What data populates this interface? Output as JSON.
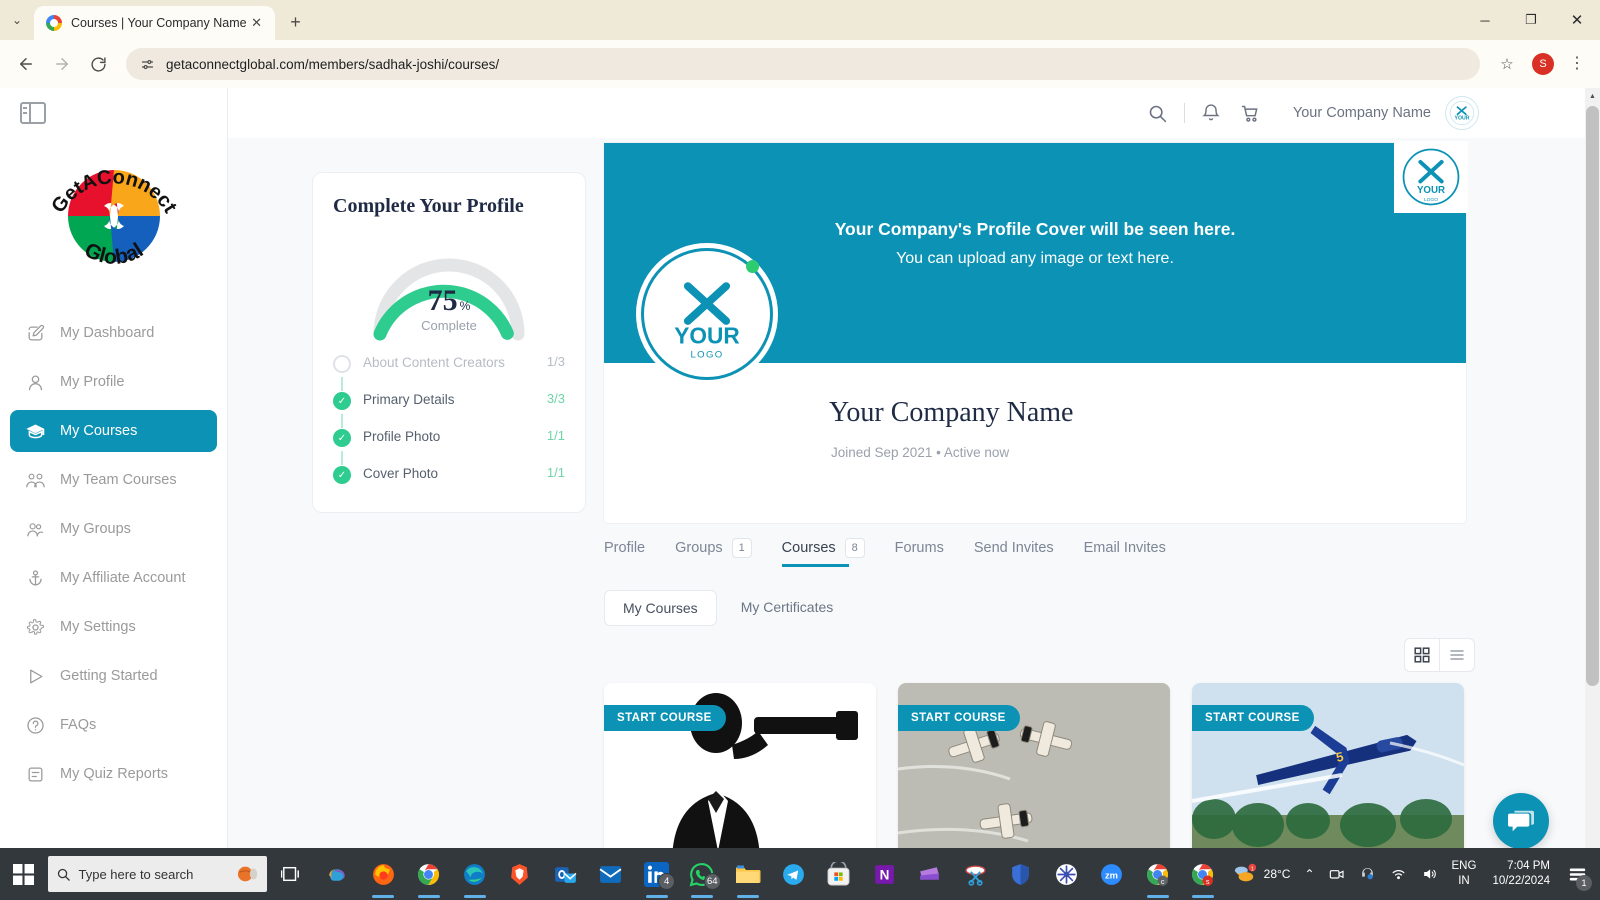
{
  "browser": {
    "tab_title": "Courses | Your Company Name",
    "url": "getaconnectglobal.com/members/sadhak-joshi/courses/",
    "new_tab_label": "+",
    "close_label": "✕",
    "back_label": "←",
    "forward_label": "→",
    "reload_label": "⟳",
    "star_label": "☆",
    "profile_initial": "S",
    "menu_label": "⋮",
    "minimize_label": "─",
    "maximize_label": "❐",
    "win_close_label": "✕",
    "chevron_label": "⌄"
  },
  "sidebar": {
    "toggle_name": "panel-toggle",
    "logo_text_top": "GetAConnect",
    "logo_text_bottom": "Global",
    "items": [
      {
        "label": "My Dashboard",
        "icon": "edit-square-icon",
        "active": false
      },
      {
        "label": "My Profile",
        "icon": "person-icon",
        "active": false
      },
      {
        "label": "My Courses",
        "icon": "graduation-cap-icon",
        "active": true
      },
      {
        "label": "My Team Courses",
        "icon": "people-group-icon",
        "active": false
      },
      {
        "label": "My Groups",
        "icon": "two-people-icon",
        "active": false
      },
      {
        "label": "My Affiliate Account",
        "icon": "anchor-icon",
        "active": false
      },
      {
        "label": "My Settings",
        "icon": "gear-icon",
        "active": false
      },
      {
        "label": "Getting Started",
        "icon": "play-triangle-icon",
        "active": false
      },
      {
        "label": "FAQs",
        "icon": "question-circle-icon",
        "active": false
      },
      {
        "label": "My Quiz Reports",
        "icon": "document-lines-icon",
        "active": false
      }
    ]
  },
  "appheader": {
    "search_icon": "search-icon",
    "bell_icon": "bell-icon",
    "cart_icon": "cart-icon",
    "user_name": "Your Company Name",
    "avatar_name": "user-avatar"
  },
  "profile_card": {
    "title": "Complete Your Profile",
    "percent": "75",
    "percent_symbol": "%",
    "complete_label": "Complete",
    "percent_value": 75,
    "steps": [
      {
        "label": "About Content Creators",
        "count": "1/3",
        "done": false
      },
      {
        "label": "Primary Details",
        "count": "3/3",
        "done": true
      },
      {
        "label": "Profile Photo",
        "count": "1/1",
        "done": true
      },
      {
        "label": "Cover Photo",
        "count": "1/1",
        "done": true
      }
    ]
  },
  "cover": {
    "line1": "Your Company's Profile Cover will be seen here.",
    "line2": "You can upload any image or text here.",
    "company_name": "Your Company Name",
    "meta": "Joined Sep 2021 • Active now",
    "logo_main": "YOUR",
    "logo_sub": "LOGO",
    "accent_color": "#0c92b5"
  },
  "tabs": [
    {
      "label": "Profile",
      "badge": "",
      "active": false
    },
    {
      "label": "Groups",
      "badge": "1",
      "active": false
    },
    {
      "label": "Courses",
      "badge": "8",
      "active": true
    },
    {
      "label": "Forums",
      "badge": "",
      "active": false
    },
    {
      "label": "Send Invites",
      "badge": "",
      "active": false
    },
    {
      "label": "Email Invites",
      "badge": "",
      "active": false
    }
  ],
  "subtabs": [
    {
      "label": "My Courses",
      "active": true
    },
    {
      "label": "My Certificates",
      "active": false
    }
  ],
  "view_toggle": {
    "grid_icon": "grid-view-icon",
    "list_icon": "list-view-icon"
  },
  "courses": [
    {
      "badge": "START COURSE",
      "thumb": "businessman-telescope"
    },
    {
      "badge": "START COURSE",
      "thumb": "jets-formation"
    },
    {
      "badge": "START COURSE",
      "thumb": "blue-jet"
    }
  ],
  "chat": {
    "icon": "chat-bubble-icon"
  },
  "taskbar": {
    "start_icon": "windows-start-icon",
    "search_placeholder": "Type here to search",
    "search_icon": "search-icon",
    "cortana_icon": "cortana-icon",
    "taskview_icon": "task-view-icon",
    "apps": [
      {
        "name": "copilot-icon",
        "badge": "",
        "running": false
      },
      {
        "name": "firefox-icon",
        "badge": "",
        "running": true
      },
      {
        "name": "chrome-icon",
        "badge": "",
        "running": true
      },
      {
        "name": "edge-icon",
        "badge": "",
        "running": true
      },
      {
        "name": "brave-icon",
        "badge": "",
        "running": false
      },
      {
        "name": "outlook-classic-icon",
        "badge": "",
        "running": false
      },
      {
        "name": "outlook-new-icon",
        "badge": "",
        "running": false
      },
      {
        "name": "linkedin-icon",
        "badge": "4",
        "running": true
      },
      {
        "name": "whatsapp-icon",
        "badge": "64",
        "running": true
      },
      {
        "name": "file-explorer-icon",
        "badge": "",
        "running": true
      },
      {
        "name": "telegram-icon",
        "badge": "",
        "running": false
      },
      {
        "name": "microsoft-store-icon",
        "badge": "",
        "running": false
      },
      {
        "name": "onenote-icon",
        "badge": "",
        "running": false
      },
      {
        "name": "clipchamp-icon",
        "badge": "",
        "running": false
      },
      {
        "name": "snipping-tool-icon",
        "badge": "",
        "running": false
      },
      {
        "name": "windows-security-icon",
        "badge": "",
        "running": false
      },
      {
        "name": "sunburst-icon",
        "badge": "",
        "running": false
      },
      {
        "name": "zoom-icon",
        "badge": "",
        "running": false
      },
      {
        "name": "chrome-profile-c-icon",
        "badge": "",
        "running": true
      },
      {
        "name": "chrome-profile-s-icon",
        "badge": "",
        "running": true
      }
    ],
    "tray": {
      "weather_temp": "28°C",
      "chevron": "⌃",
      "camera_icon": "camera-icon",
      "headset_icon": "headset-icon",
      "wifi_icon": "wifi-icon",
      "volume_icon": "volume-icon",
      "lang_line1": "ENG",
      "lang_line2": "IN",
      "time": "7:04 PM",
      "date": "10/22/2024",
      "notification_count": "1"
    }
  }
}
